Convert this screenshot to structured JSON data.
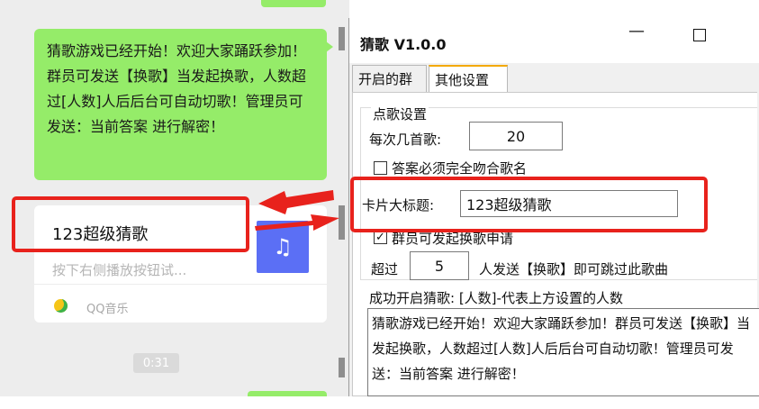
{
  "chat": {
    "message_text": "猜歌游戏已经开始！欢迎大家踊跃参加！群员可发送【换歌】当发起换歌，人数超过[人数]人后后台可自动切歌！管理员可发送：当前答案 进行解密！",
    "card": {
      "title": "123超级猜歌",
      "description": "按下右侧播放按钮试...",
      "source": "QQ音乐",
      "thumb_glyph": "♫"
    },
    "timestamp": "0:31"
  },
  "window": {
    "title": "猜歌 V1.0.0",
    "minimize_glyph": "—",
    "tabs": [
      {
        "label": "开启的群"
      },
      {
        "label": "其他设置"
      }
    ],
    "active_tab": 1,
    "group_title": "点歌设置",
    "songs_label": "每次几首歌:",
    "songs_value": "20",
    "exact_match_label": "答案必须完全吻合歌名",
    "exact_match_checked": false,
    "card_title_label": "卡片大标题:",
    "card_title_value": "123超级猜歌",
    "allow_change_label": "群员可发起换歌申请",
    "allow_change_checked": true,
    "threshold_prefix": "超过",
    "threshold_value": "5",
    "threshold_suffix": "人发送【换歌】即可跳过此歌曲",
    "success_label": "成功开启猜歌:  [人数]-代表上方设置的人数",
    "success_message": "猜歌游戏已经开始！欢迎大家踊跃参加！群员可发送【换歌】当发起换歌，人数超过[人数]人后后台可自动切歌！管理员可发送：当前答案 进行解密！"
  },
  "colors": {
    "chat_bubble": "#95ec69",
    "annotation_red": "#e8221c",
    "tab_accent": "#f3a900",
    "thumb_blue": "#5b6ff5"
  },
  "icons": [
    "music-note-icon",
    "qq-music-icon",
    "checkmark-icon",
    "annotation-arrow"
  ]
}
